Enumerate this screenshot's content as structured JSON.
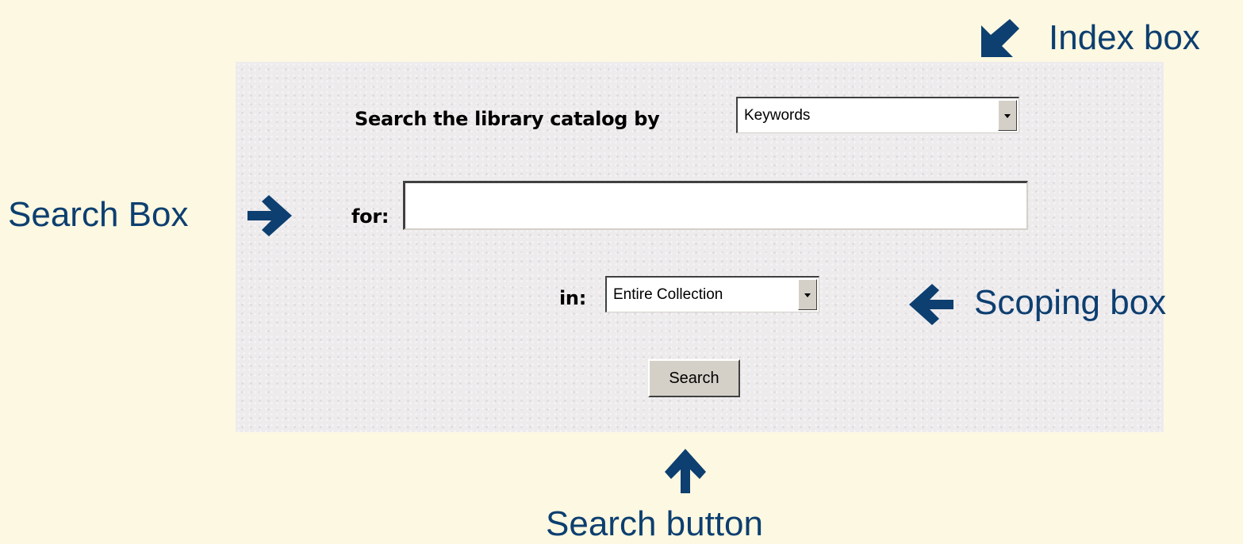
{
  "form": {
    "index_label": "Search the library catalog by",
    "index_value": "Keywords",
    "search_label": "for:",
    "search_value": "",
    "scope_label": "in:",
    "scope_value": "Entire Collection",
    "search_button": "Search"
  },
  "annotations": {
    "index_box": "Index box",
    "search_box": "Search Box",
    "scoping_box": "Scoping box",
    "search_button": "Search button"
  },
  "colors": {
    "page_background": "#fdf8e1",
    "annotation_text": "#0d3f70",
    "panel_background": "#eeebed"
  },
  "icons": {
    "index_arrow": "arrow-down-left-icon",
    "search_box_arrow": "arrow-right-icon",
    "scoping_arrow": "arrow-left-icon",
    "button_arrow": "arrow-up-icon"
  }
}
